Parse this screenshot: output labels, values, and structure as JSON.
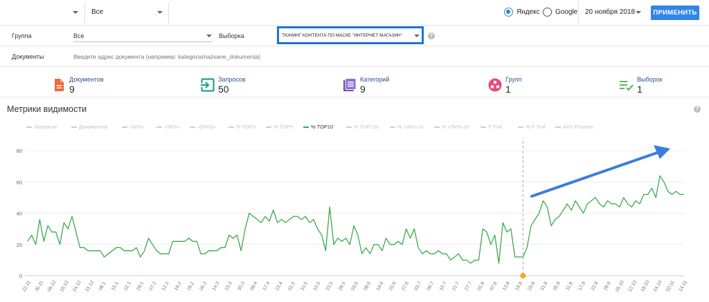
{
  "topbar": {
    "project_value": "",
    "scope_value": "Все",
    "engines": [
      {
        "label": "Яндекс",
        "selected": true
      },
      {
        "label": "Google",
        "selected": false
      }
    ],
    "date": "20 ноября 2018",
    "apply_label": "ПРИМЕНИТЬ"
  },
  "filters": {
    "group_label": "Группа",
    "group_value": "Все",
    "selection_label": "Выборка",
    "selection_value": "ТЮНИНГ КОНТЕНТА ПО МАСКЕ \"ИНТЕРНЕТ МАГАЗИН\"",
    "help": "?"
  },
  "documents": {
    "label": "Документы",
    "placeholder": "Введите адрес документа (например: kategoria/nazvane_dokumenta)"
  },
  "stats": [
    {
      "name": "Документов",
      "value": "9",
      "icon": "document-icon",
      "color": "#f06a3b"
    },
    {
      "name": "Запросов",
      "value": "50",
      "icon": "enter-icon",
      "color": "#1fa187"
    },
    {
      "name": "Категорий",
      "value": "9",
      "icon": "list-icon",
      "color": "#6d4fb5"
    },
    {
      "name": "Групп",
      "value": "1",
      "icon": "group-icon",
      "color": "#e84a7a"
    },
    {
      "name": "Выборок",
      "value": "1",
      "icon": "checklist-icon",
      "color": "#5cb85c"
    }
  ],
  "metrics": {
    "title": "Метрики видимости",
    "help": "?",
    "legend": [
      {
        "label": "Запросов",
        "active": false
      },
      {
        "label": "Документов",
        "active": false
      },
      {
        "label": "«WS»",
        "active": false
      },
      {
        "label": "«!WS»",
        "active": false
      },
      {
        "label": "«[!WS]»",
        "active": false
      },
      {
        "label": "% TOP3",
        "active": false
      },
      {
        "label": "% TOP5",
        "active": false
      },
      {
        "label": "% TOP10",
        "active": true
      },
      {
        "label": "% TOP100",
        "active": false
      },
      {
        "label": "% «WS»10",
        "active": false
      },
      {
        "label": "% «!WS»10",
        "active": false
      },
      {
        "label": "P Traf",
        "active": false
      },
      {
        "label": "% P Traf",
        "active": false
      },
      {
        "label": "AVG Position",
        "active": false
      }
    ]
  },
  "chart_data": {
    "type": "line",
    "series_color": "#3aaa4a",
    "marker_color": "#f5a623",
    "arrow_color": "#3b7ddd",
    "ylim": [
      0,
      88
    ],
    "yticks": [
      0,
      20,
      40,
      60,
      80
    ],
    "grid": true,
    "xticks": [
      "22.11",
      "30.11",
      "09.12",
      "16.12",
      "24.12",
      "31.12",
      "08.1",
      "15.1",
      "22.1",
      "29.1",
      "07.2",
      "12.2",
      "19.2",
      "26.2",
      "05.3",
      "14.3",
      "23.3",
      "30.3",
      "09.4",
      "17.4",
      "23.4",
      "01.5",
      "10.5",
      "15.5",
      "23.5",
      "29.5",
      "03.6",
      "09.6",
      "14.6",
      "20.6",
      "27.6",
      "03.7",
      "09.7",
      "15.7",
      "21.7",
      "27.7",
      "01.8",
      "07.8",
      "13.8",
      "19.8",
      "25.8",
      "31.8",
      "05.9",
      "11.9",
      "17.9",
      "23.9",
      "29.9",
      "05.10",
      "12.10",
      "18.10",
      "24.10",
      "02.11",
      "14.11"
    ],
    "marker_index": 123,
    "values": [
      22,
      26,
      20,
      36,
      22,
      32,
      28,
      28,
      20,
      34,
      30,
      38,
      28,
      18,
      18,
      16,
      16,
      16,
      16,
      12,
      14,
      16,
      18,
      18,
      16,
      16,
      16,
      18,
      12,
      16,
      24,
      20,
      16,
      14,
      14,
      14,
      22,
      22,
      22,
      22,
      24,
      22,
      22,
      14,
      14,
      16,
      16,
      16,
      18,
      18,
      26,
      24,
      26,
      16,
      30,
      40,
      38,
      36,
      34,
      38,
      35,
      42,
      34,
      36,
      34,
      36,
      38,
      38,
      36,
      38,
      34,
      36,
      30,
      26,
      16,
      44,
      20,
      24,
      22,
      24,
      20,
      32,
      26,
      14,
      18,
      14,
      20,
      20,
      16,
      24,
      20,
      20,
      22,
      20,
      30,
      24,
      30,
      18,
      14,
      16,
      14,
      14,
      16,
      14,
      14,
      10,
      12,
      14,
      10,
      10,
      8,
      10,
      10,
      30,
      28,
      20,
      26,
      8,
      34,
      28,
      30,
      12,
      12,
      12,
      18,
      32,
      36,
      40,
      48,
      44,
      32,
      36,
      38,
      42,
      46,
      42,
      48,
      44,
      40,
      46,
      48,
      50,
      46,
      44,
      48,
      46,
      46,
      44,
      50,
      46,
      44,
      48,
      46,
      52,
      52,
      56,
      50,
      64,
      60,
      54,
      52,
      54,
      52,
      52
    ]
  }
}
